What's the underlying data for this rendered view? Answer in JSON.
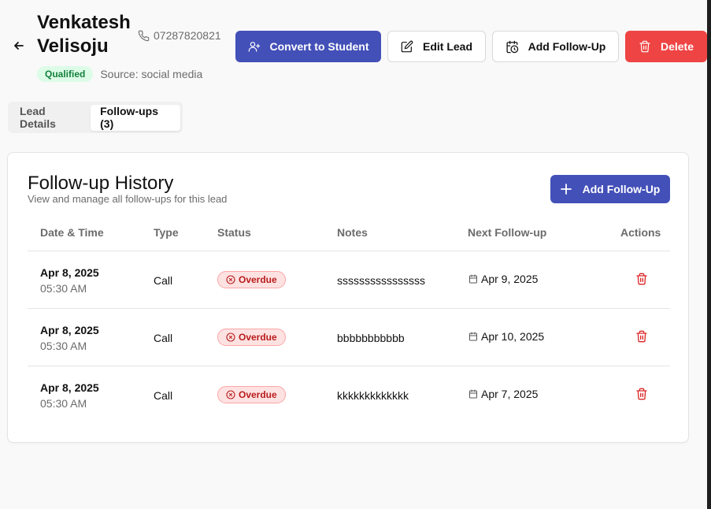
{
  "lead": {
    "name": "Venkatesh Velisoju",
    "phone": "07287820821",
    "status": "Qualified",
    "source": "Source: social media"
  },
  "actions": {
    "convert": "Convert to Student",
    "edit": "Edit Lead",
    "add_followup": "Add Follow-Up",
    "delete": "Delete"
  },
  "tabs": [
    {
      "label": "Lead Details",
      "active": false
    },
    {
      "label": "Follow-ups (3)",
      "active": true
    }
  ],
  "history": {
    "title": "Follow-up History",
    "subtitle": "View and manage all follow-ups for this lead",
    "add_label": "Add Follow-Up",
    "columns": [
      "Date & Time",
      "Type",
      "Status",
      "Notes",
      "Next Follow-up",
      "Actions"
    ],
    "rows": [
      {
        "date": "Apr 8, 2025",
        "time": "05:30 AM",
        "type": "Call",
        "status": "Overdue",
        "notes": "ssssssssssssssss",
        "next": "Apr 9, 2025"
      },
      {
        "date": "Apr 8, 2025",
        "time": "05:30 AM",
        "type": "Call",
        "status": "Overdue",
        "notes": "bbbbbbbbbbb",
        "next": "Apr 10, 2025"
      },
      {
        "date": "Apr 8, 2025",
        "time": "05:30 AM",
        "type": "Call",
        "status": "Overdue",
        "notes": "kkkkkkkkkkkkk",
        "next": "Apr 7, 2025"
      }
    ]
  },
  "colors": {
    "primary": "#4350b8",
    "danger": "#ef4444",
    "qualified_bg": "#dcfce7",
    "qualified_text": "#15803d",
    "overdue_bg": "#fee2e2",
    "overdue_text": "#b91c1c"
  },
  "icons": {
    "back": "arrow-left-icon",
    "phone": "phone-icon",
    "convert": "user-plus-icon",
    "edit": "edit-icon",
    "add_followup": "calendar-clock-icon",
    "delete": "trash-icon",
    "add": "plus-icon",
    "overdue": "x-circle-icon",
    "next_followup": "calendar-icon",
    "row_delete": "trash-icon"
  }
}
